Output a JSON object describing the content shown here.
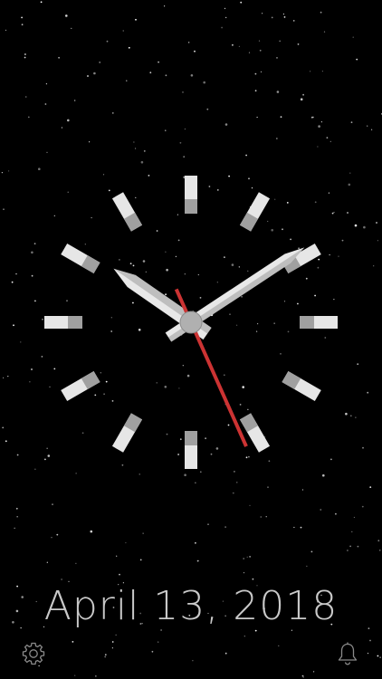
{
  "date": {
    "text": "April 13, 2018"
  },
  "clock": {
    "time": {
      "hours": 10,
      "minutes": 9,
      "seconds": 26
    },
    "colors": {
      "background": "#000000",
      "marker": "#e6e6e6",
      "marker_shade": "#a0a0a0",
      "hand": "#e8e8e8",
      "hand_shade": "#9a9a9a",
      "second_hand": "#cc3333",
      "hub": "#b0b0b0",
      "date_text": "#c9c9c9"
    }
  },
  "toolbar": {
    "settings_icon": "gear-icon",
    "alarm_icon": "bell-icon",
    "icon_color": "#8a8a8a"
  }
}
